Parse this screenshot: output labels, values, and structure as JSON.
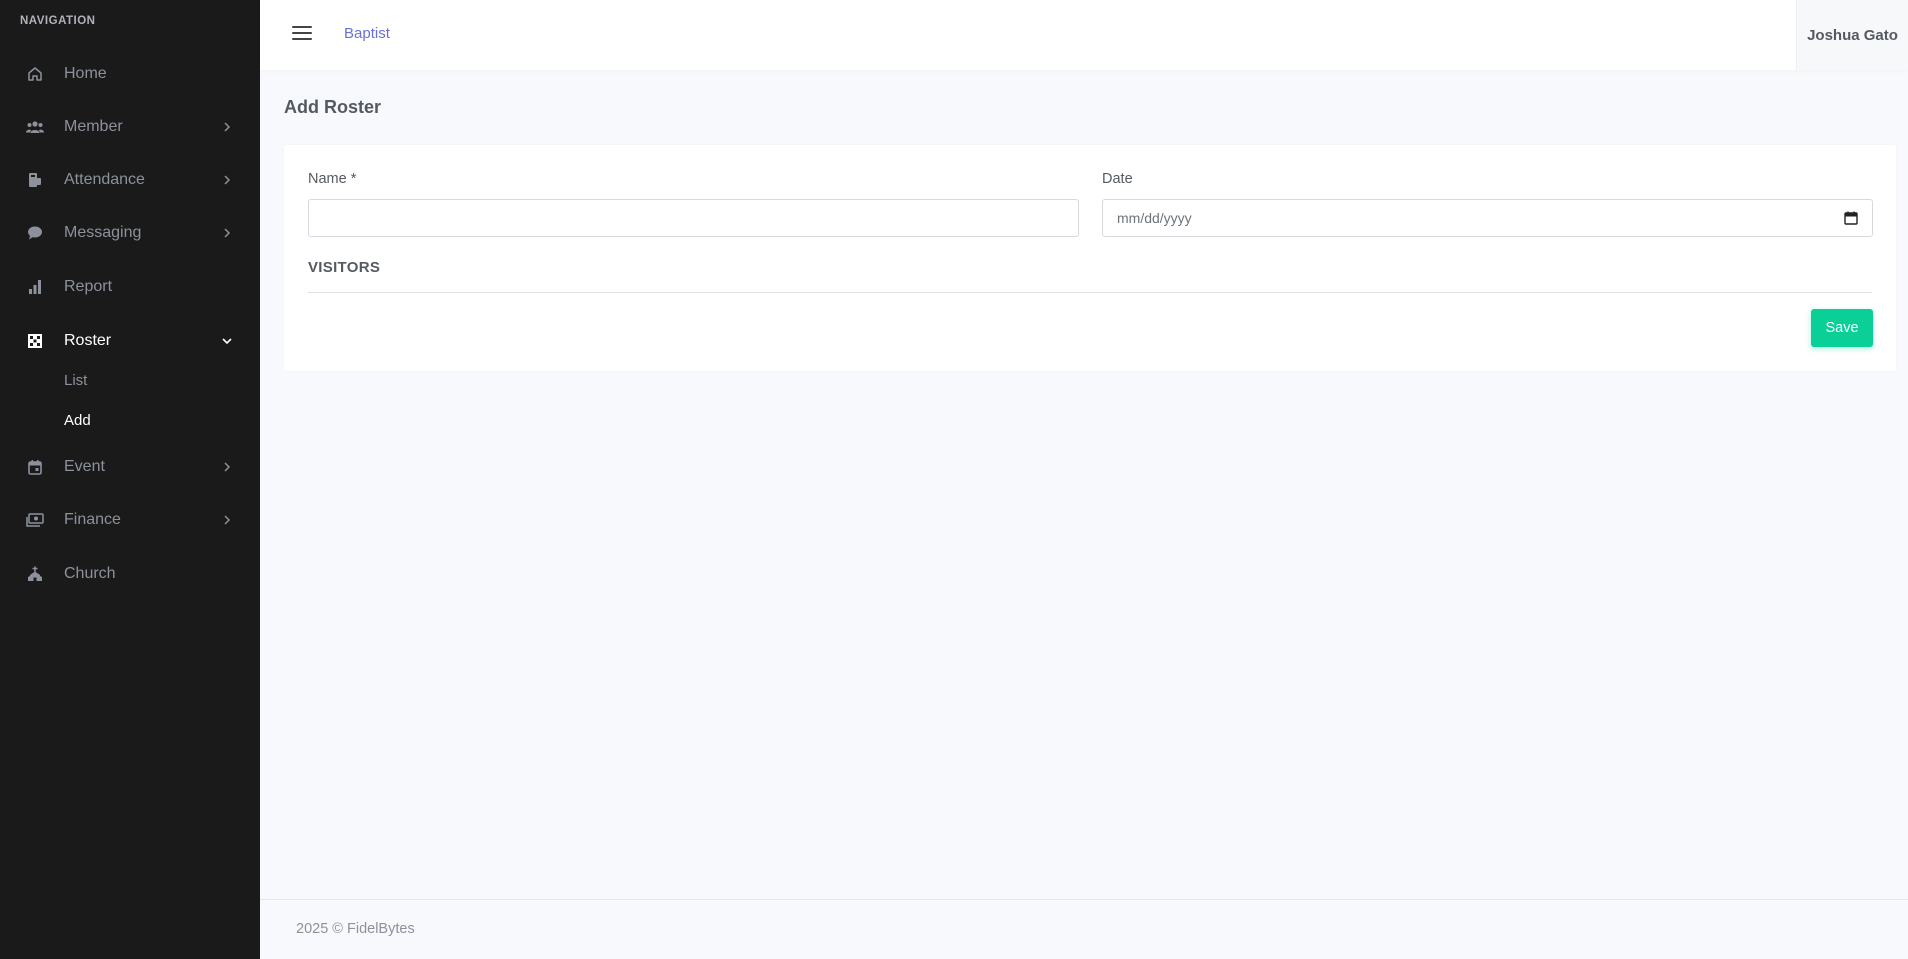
{
  "sidebar": {
    "heading": "NAVIGATION",
    "items": [
      {
        "label": "Home",
        "icon": "home-icon"
      },
      {
        "label": "Member",
        "icon": "users-icon"
      },
      {
        "label": "Attendance",
        "icon": "attendance-icon"
      },
      {
        "label": "Messaging",
        "icon": "chat-icon"
      },
      {
        "label": "Report",
        "icon": "bar-chart-icon"
      },
      {
        "label": "Roster",
        "icon": "roster-icon"
      },
      {
        "label": "Event",
        "icon": "calendar-icon"
      },
      {
        "label": "Finance",
        "icon": "cash-icon"
      },
      {
        "label": "Church",
        "icon": "church-icon"
      }
    ],
    "roster_sub": [
      {
        "label": "List"
      },
      {
        "label": "Add"
      }
    ]
  },
  "topbar": {
    "brand": "Baptist",
    "user": "Joshua Gato"
  },
  "page": {
    "title": "Add Roster"
  },
  "form": {
    "name_label": "Name *",
    "name_value": "",
    "date_label": "Date",
    "date_placeholder": "mm/dd/yyyy",
    "visitors_label": "VISITORS",
    "save_label": "Save"
  },
  "footer": {
    "text": "2025 © FidelBytes"
  },
  "colors": {
    "sidebar_bg": "#1a1a1a",
    "brand_link": "#6b6fd8",
    "save_button": "#0acf97"
  }
}
